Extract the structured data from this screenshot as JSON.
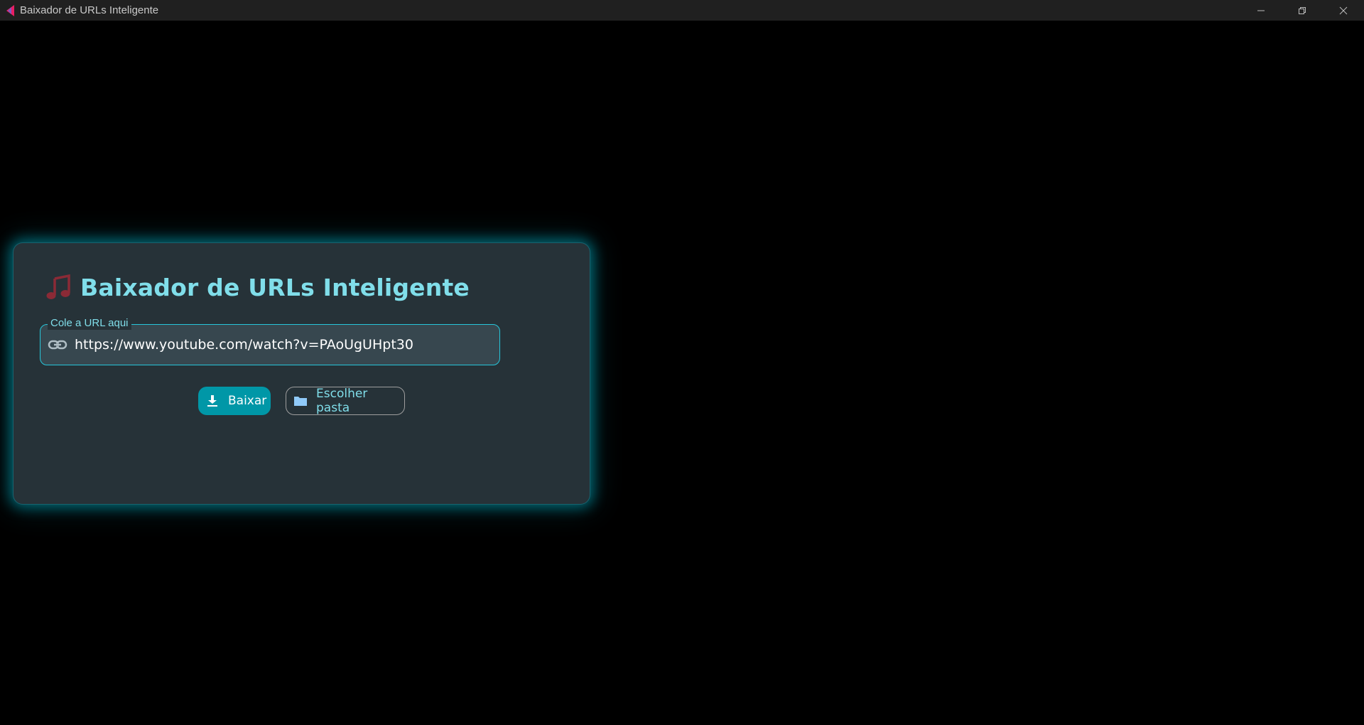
{
  "window": {
    "title": "Baixador de URLs Inteligente",
    "controls": [
      "minimize-icon",
      "restore-icon",
      "close-icon"
    ]
  },
  "card": {
    "title": "Baixador de URLs Inteligente",
    "title_icon": "music-note-icon",
    "url_field": {
      "label": "Cole a URL aqui",
      "value": "https://www.youtube.com/watch?v=PAoUgUHpt30",
      "icon": "link-icon"
    },
    "buttons": {
      "download_label": "Baixar",
      "download_icon": "download-icon",
      "folder_label": "Escolher pasta",
      "folder_icon": "folder-icon"
    }
  },
  "colors": {
    "background": "#000000",
    "titlebar": "#202020",
    "card": "#263238",
    "accent": "#80deea",
    "glow": "#00acc1",
    "primary_button": "#0097a7",
    "music_icon": "#8b2a36"
  }
}
